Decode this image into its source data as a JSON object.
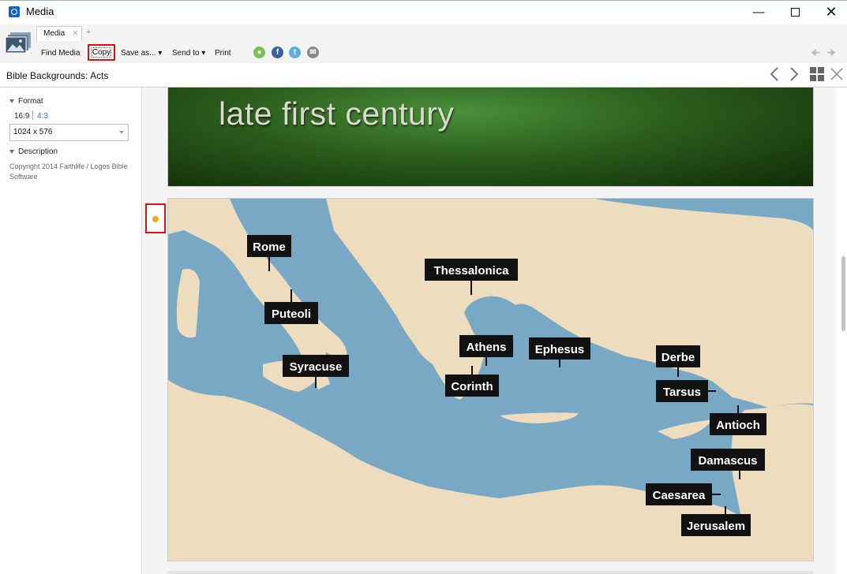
{
  "window": {
    "title": "Media"
  },
  "tabs": [
    {
      "label": "Media"
    }
  ],
  "toolbar": {
    "find_media": "Find Media",
    "copy": "Copy",
    "save_as": "Save as... ▾",
    "send_to": "Send to ▾",
    "print": "Print"
  },
  "header": {
    "title": "Bible Backgrounds: Acts"
  },
  "sidebar": {
    "format_heading": "Format",
    "format_options": [
      "16:9",
      "4:3"
    ],
    "size_selected": "1024 x 576",
    "description_heading": "Description",
    "description_text": "Copyright 2014 Faithlife / Logos Bible Software"
  },
  "slides": {
    "slide1_text": "late first century"
  },
  "map": {
    "cities": [
      "Rome",
      "Thessalonica",
      "Puteoli",
      "Athens",
      "Ephesus",
      "Derbe",
      "Syracuse",
      "Corinth",
      "Tarsus",
      "Antioch",
      "Damascus",
      "Caesarea",
      "Jerusalem"
    ]
  },
  "colors": {
    "highlight": "#e01010",
    "sea": "#78a8c4",
    "land": "#eddcbe",
    "marker": "#f5a623"
  },
  "icons": [
    "app-logo-icon",
    "media-gallery-icon",
    "minimize-icon",
    "maximize-icon",
    "close-icon",
    "plus-icon",
    "drop-icon",
    "facebook-icon",
    "twitter-icon",
    "email-icon",
    "back-arrow-icon",
    "forward-arrow-icon",
    "chevron-left-icon",
    "chevron-right-icon",
    "grid-icon"
  ]
}
